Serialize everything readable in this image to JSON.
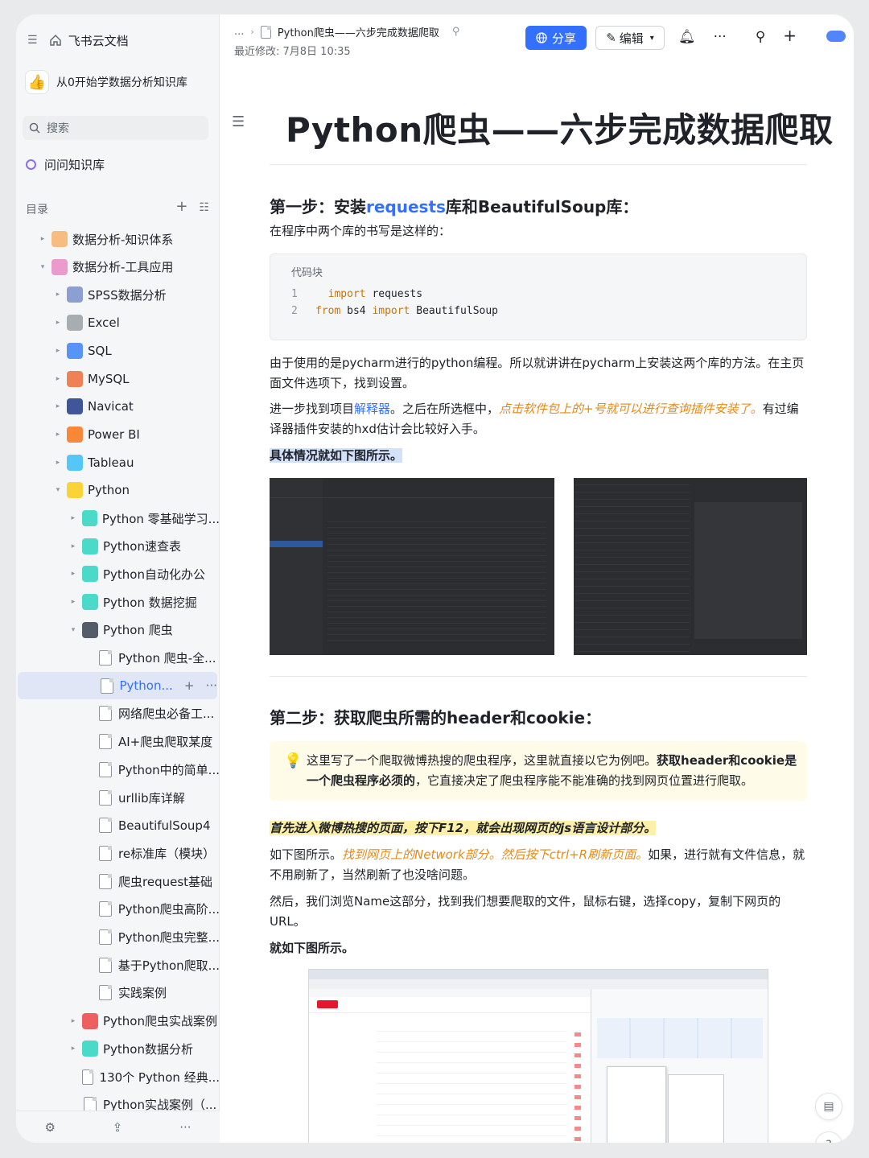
{
  "app": {
    "name": "飞书云文档"
  },
  "knowledge_base": {
    "emoji": "👍",
    "name": "从0开始学数据分析知识库"
  },
  "search": {
    "placeholder": "搜索"
  },
  "ask": {
    "label": "问问知识库"
  },
  "toc": {
    "label": "目录",
    "items": [
      {
        "label": "数据分析-知识体系",
        "level": 0,
        "arrow": "▸",
        "icon": "orange-square-icon",
        "color": "#f6b26b"
      },
      {
        "label": "数据分析-工具应用",
        "level": 0,
        "arrow": "▾",
        "icon": "pink-square-icon",
        "color": "#e78ac3"
      },
      {
        "label": "SPSS数据分析",
        "level": 1,
        "arrow": "▸",
        "icon": "spss-icon",
        "color": "#7a8fc9"
      },
      {
        "label": "Excel",
        "level": 1,
        "arrow": "▸",
        "icon": "chart-icon",
        "color": "#9aa0a6"
      },
      {
        "label": "SQL",
        "level": 1,
        "arrow": "▸",
        "icon": "spiral-icon",
        "color": "#3b82f6"
      },
      {
        "label": "MySQL",
        "level": 1,
        "arrow": "▸",
        "icon": "dolphin-icon",
        "color": "#ef6c3a"
      },
      {
        "label": "Navicat",
        "level": 1,
        "arrow": "▸",
        "icon": "navicat-icon",
        "color": "#1e3a8a"
      },
      {
        "label": "Power BI",
        "level": 1,
        "arrow": "▸",
        "icon": "fire-icon",
        "color": "#f97316"
      },
      {
        "label": "Tableau",
        "level": 1,
        "arrow": "▸",
        "icon": "drop-icon",
        "color": "#38bdf8"
      },
      {
        "label": "Python",
        "level": 1,
        "arrow": "▾",
        "icon": "python-icon",
        "color": "#facc15"
      },
      {
        "label": "Python 零基础学习...",
        "level": 2,
        "arrow": "▸",
        "icon": "teal-doc-icon",
        "color": "#2dd4bf"
      },
      {
        "label": "Python速查表",
        "level": 2,
        "arrow": "▸",
        "icon": "teal-doc-icon",
        "color": "#2dd4bf"
      },
      {
        "label": "Python自动化办公",
        "level": 2,
        "arrow": "▸",
        "icon": "teal-doc-icon",
        "color": "#2dd4bf"
      },
      {
        "label": "Python 数据挖掘",
        "level": 2,
        "arrow": "▸",
        "icon": "teal-doc-icon",
        "color": "#2dd4bf"
      },
      {
        "label": "Python 爬虫",
        "level": 2,
        "arrow": "▾",
        "icon": "spider-icon",
        "color": "#374151"
      },
      {
        "label": "Python 爬虫-全...",
        "level": 3,
        "arrow": "",
        "icon": "doc-icon",
        "color": ""
      },
      {
        "label": "Python...",
        "level": 3,
        "arrow": "",
        "icon": "doc-icon",
        "color": "",
        "active": true
      },
      {
        "label": "网络爬虫必备工...",
        "level": 3,
        "arrow": "",
        "icon": "doc-icon",
        "color": ""
      },
      {
        "label": "AI+爬虫爬取某度",
        "level": 3,
        "arrow": "",
        "icon": "doc-icon",
        "color": ""
      },
      {
        "label": "Python中的简单...",
        "level": 3,
        "arrow": "",
        "icon": "doc-icon",
        "color": ""
      },
      {
        "label": "urllib库详解",
        "level": 3,
        "arrow": "",
        "icon": "doc-icon",
        "color": ""
      },
      {
        "label": "BeautifulSoup4",
        "level": 3,
        "arrow": "",
        "icon": "doc-icon",
        "color": ""
      },
      {
        "label": "re标准库（模块）",
        "level": 3,
        "arrow": "",
        "icon": "doc-icon",
        "color": ""
      },
      {
        "label": "爬虫request基础",
        "level": 3,
        "arrow": "",
        "icon": "doc-icon",
        "color": ""
      },
      {
        "label": "Python爬虫高阶...",
        "level": 3,
        "arrow": "",
        "icon": "doc-icon",
        "color": ""
      },
      {
        "label": "Python爬虫完整...",
        "level": 3,
        "arrow": "",
        "icon": "doc-icon",
        "color": ""
      },
      {
        "label": "基于Python爬取...",
        "level": 3,
        "arrow": "",
        "icon": "doc-icon",
        "color": ""
      },
      {
        "label": "实践案例",
        "level": 3,
        "arrow": "",
        "icon": "doc-icon",
        "color": ""
      },
      {
        "label": "Python爬虫实战案例",
        "level": 2,
        "arrow": "▸",
        "icon": "target-icon",
        "color": "#ef4444"
      },
      {
        "label": "Python数据分析",
        "level": 2,
        "arrow": "▸",
        "icon": "teal-doc-icon",
        "color": "#2dd4bf"
      },
      {
        "label": "130个 Python 经典...",
        "level": 2,
        "arrow": "",
        "icon": "doc-icon",
        "color": ""
      },
      {
        "label": "Python实战案例（...",
        "level": 2,
        "arrow": "",
        "icon": "doc-icon",
        "color": ""
      }
    ]
  },
  "header": {
    "ellipsis": "...",
    "doc_title": "Python爬虫——六步完成数据爬取",
    "modified": "最近修改: 7月8日 10:35",
    "share_label": "分享",
    "edit_label": "编辑"
  },
  "doc": {
    "title": "Python爬虫——六步完成数据爬取",
    "step1": {
      "prefix": "第一步：安装",
      "link": "requests",
      "suffix": "库和BeautifulSoup库："
    },
    "step1_intro": "在程序中两个库的书写是这样的：",
    "code": {
      "label": "代码块",
      "lines": [
        {
          "num": "1",
          "kw": "import",
          "rest": " requests",
          "indent": "  "
        },
        {
          "num": "2",
          "kw": "from",
          "rest": " bs4 ",
          "kw2": "import",
          "rest2": " BeautifulSoup",
          "indent": ""
        }
      ]
    },
    "p1": "由于使用的是pycharm进行的python编程。所以就讲讲在pycharm上安装这两个库的方法。在主页面文件选项下，找到设置。",
    "p2": {
      "a": "进一步找到项目",
      "link": "解释器",
      "b": "。之后在所选框中，",
      "orange": "点击软件包上的+号就可以进行查询插件安装了。",
      "c": "有过编译器插件安装的hxd估计会比较好入手。"
    },
    "p3": "具体情况就如下图所示。",
    "step2": "第二步：获取爬虫所需的header和cookie：",
    "callout": {
      "a": "这里写了一个爬取微博热搜的爬虫程序，这里就直接以它为例吧。",
      "b": "获取header和cookie是一个爬虫程序必须的",
      "c": "，它直接决定了爬虫程序能不能准确的找到网页位置进行爬取。"
    },
    "p4": "首先进入微博热搜的页面，按下F12，就会出现网页的js语言设计部分。",
    "p5": {
      "a": "如下图所示。",
      "orange": "找到网页上的Network部分。然后按下ctrl+R刷新页面。",
      "b": "如果，进行就有文件信息，就不用刷新了，当然刷新了也没啥问题。"
    },
    "p6": "然后，我们浏览Name这部分，找到我们想要爬取的文件，鼠标右键，选择copy，复制下网页的URL。",
    "p7": "就如下图所示。"
  }
}
